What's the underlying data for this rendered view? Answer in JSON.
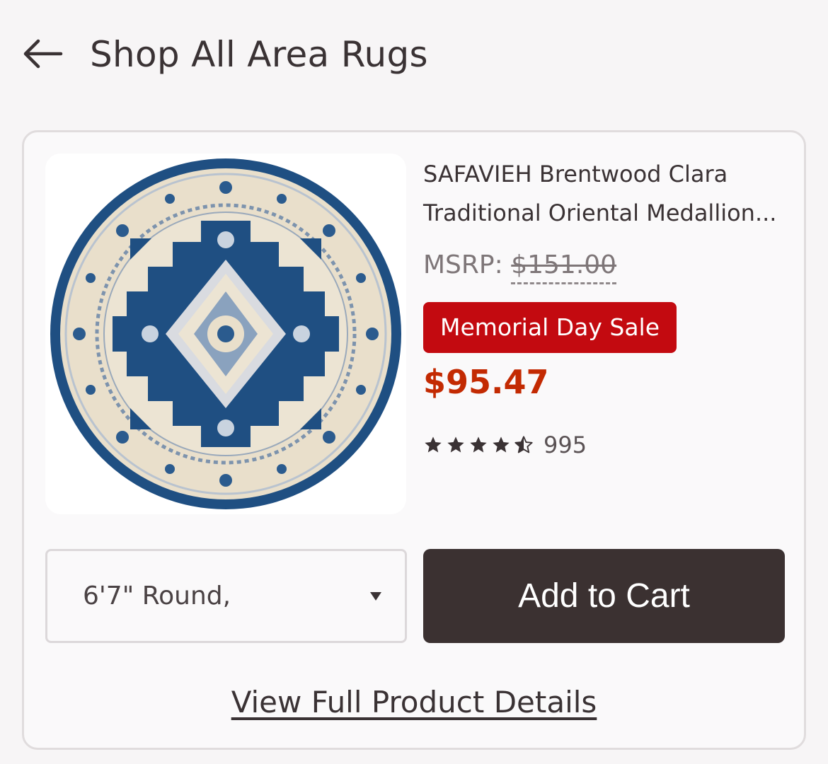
{
  "header": {
    "back_icon": "arrow-left-icon",
    "title": "Shop All Area Rugs"
  },
  "product": {
    "title": "SAFAVIEH Brentwood Clara Traditional Oriental Medallion...",
    "msrp_label": "MSRP:",
    "msrp_value": "$151.00",
    "sale_badge": "Memorial Day Sale",
    "price": "$95.47",
    "rating": 4.5,
    "review_count": "995",
    "image_icon": "round-rug-image"
  },
  "size_select": {
    "value": "6'7\" Round,",
    "caret_icon": "caret-down-icon"
  },
  "actions": {
    "add_to_cart": "Add to Cart",
    "view_details": "View Full Product Details"
  },
  "colors": {
    "sale_red": "#c30a10",
    "price_red": "#c32a02",
    "button_dark": "#3b3131",
    "rug_blue": "#1f4f82",
    "rug_cream": "#e9dfcb"
  }
}
